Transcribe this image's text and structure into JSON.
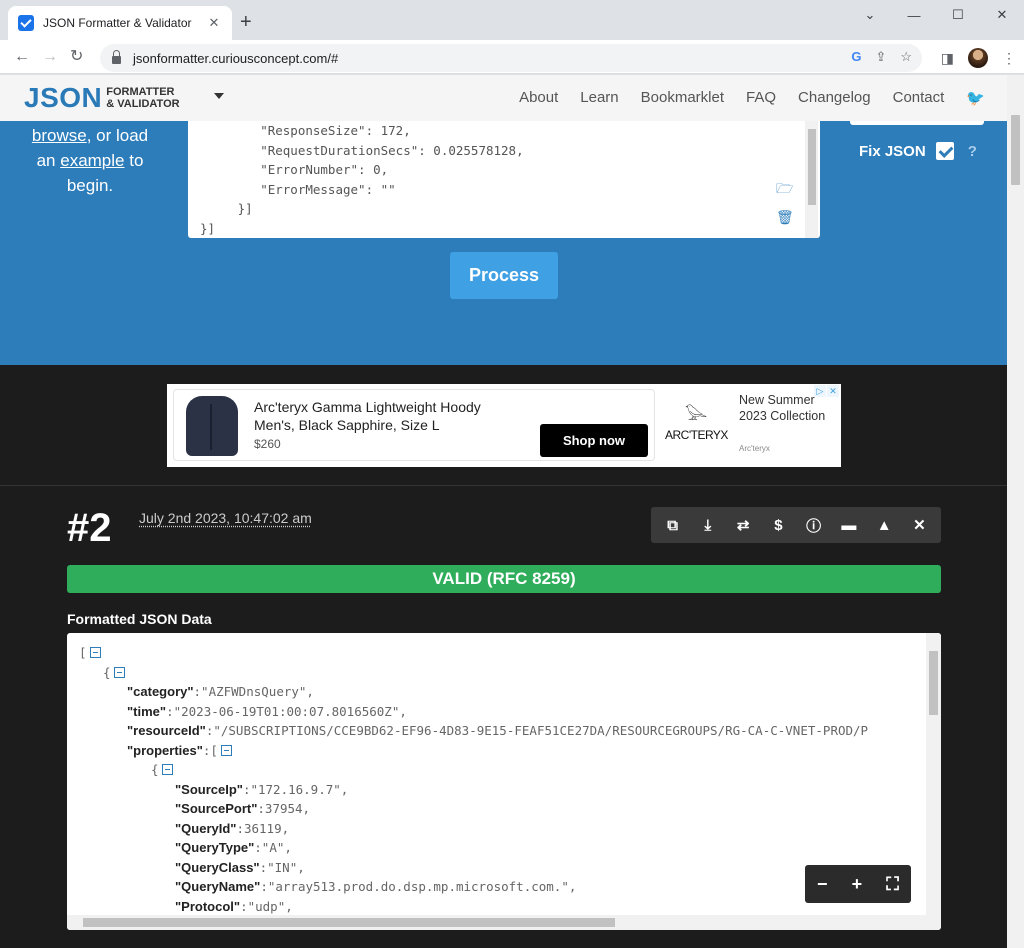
{
  "browser": {
    "tab_title": "JSON Formatter & Validator",
    "tab_close": "✕",
    "new_tab": "+",
    "url": "jsonformatter.curiousconcept.com/#",
    "window_controls": [
      "⌄",
      "—",
      "☐",
      "✕"
    ]
  },
  "header": {
    "logo_main": "JSON",
    "logo_sub1": "FORMATTER",
    "logo_sub2": "& VALIDATOR",
    "nav": [
      "About",
      "Learn",
      "Bookmarklet",
      "FAQ",
      "Changelog",
      "Contact"
    ]
  },
  "input_area": {
    "help_pre": "browse",
    "help_mid": ", or load",
    "help_line2_a": "an ",
    "help_line2_link": "example",
    "help_line2_b": " to",
    "help_line3": "begin.",
    "editor_text": "        \"ResponseSize\": 172,\n        \"RequestDurationSecs\": 0.025578128,\n        \"ErrorNumber\": 0,\n        \"ErrorMessage\": \"\"\n     }]\n}]",
    "process_label": "Process",
    "fix_json_label": "Fix JSON",
    "fix_json_checked": true,
    "fix_help": "?"
  },
  "ad": {
    "title": "Arc'teryx Gamma Lightweight Hoody Men's, Black Sapphire, Size L",
    "price": "$260",
    "cta": "Shop now",
    "brand_logo": "ARC'TERYX",
    "side_text": "New Summer 2023 Collection",
    "brand_small": "Arc'teryx"
  },
  "result": {
    "number": "#2",
    "date": "July 2nd 2023, 10:47:02 am",
    "status": "VALID (RFC 8259)",
    "formatted_label": "Formatted JSON Data",
    "action_icons": [
      "copy-icon",
      "download-icon",
      "refresh-icon",
      "dollar-icon",
      "alert-icon",
      "collapse-icon",
      "expand-icon",
      "close-icon"
    ],
    "lines": [
      {
        "indent": 0,
        "key": "",
        "value": "[",
        "toggle": true
      },
      {
        "indent": 1,
        "key": "",
        "value": "{",
        "toggle": true
      },
      {
        "indent": 2,
        "key": "\"category\"",
        "value": ":\"AZFWDnsQuery\","
      },
      {
        "indent": 2,
        "key": "\"time\"",
        "value": ":\"2023-06-19T01:00:07.8016560Z\","
      },
      {
        "indent": 2,
        "key": "\"resourceId\"",
        "value": ":\"/SUBSCRIPTIONS/CCE9BD62-EF96-4D83-9E15-FEAF51CE27DA/RESOURCEGROUPS/RG-CA-C-VNET-PROD/P"
      },
      {
        "indent": 2,
        "key": "\"properties\"",
        "value": ":[",
        "toggle": true
      },
      {
        "indent": 3,
        "key": "",
        "value": "{",
        "toggle": true
      },
      {
        "indent": 4,
        "key": "\"SourceIp\"",
        "value": ":\"172.16.9.7\","
      },
      {
        "indent": 4,
        "key": "\"SourcePort\"",
        "value": ":37954,"
      },
      {
        "indent": 4,
        "key": "\"QueryId\"",
        "value": ":36119,"
      },
      {
        "indent": 4,
        "key": "\"QueryType\"",
        "value": ":\"A\","
      },
      {
        "indent": 4,
        "key": "\"QueryClass\"",
        "value": ":\"IN\","
      },
      {
        "indent": 4,
        "key": "\"QueryName\"",
        "value": ":\"array513.prod.do.dsp.mp.microsoft.com.\","
      },
      {
        "indent": 4,
        "key": "\"Protocol\"",
        "value": ":\"udp\","
      }
    ],
    "zoom": [
      "−",
      "+",
      "⛶"
    ]
  },
  "colors": {
    "accent": "#2d7dbb",
    "valid": "#2fad5b",
    "dark_bg": "#1c1c1c"
  }
}
